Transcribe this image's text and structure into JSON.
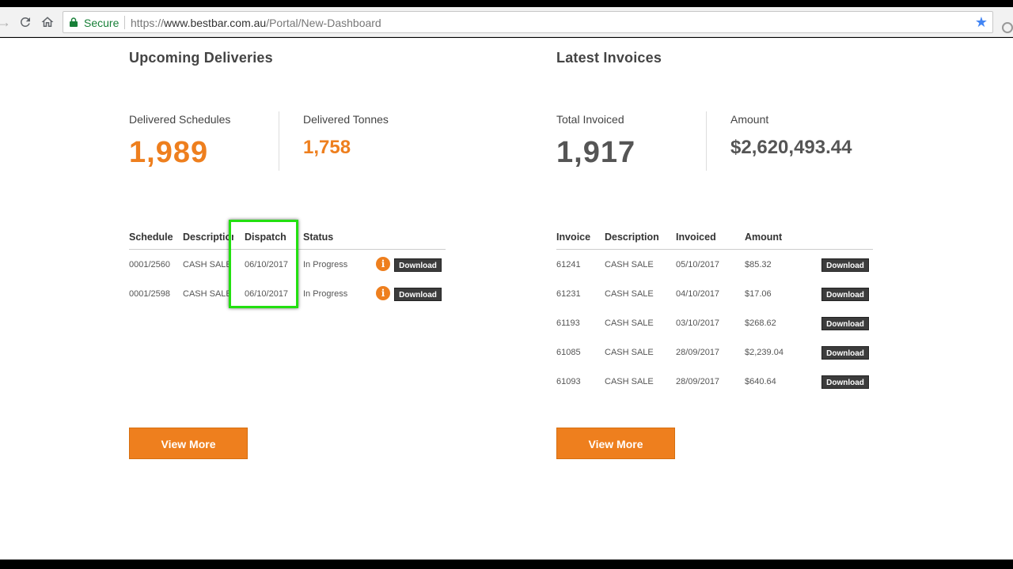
{
  "browser": {
    "secure_label": "Secure",
    "url_scheme": "https://",
    "url_host": "www.bestbar.com.au",
    "url_path": "/Portal/New-Dashboard"
  },
  "deliveries": {
    "title": "Upcoming Deliveries",
    "stats": [
      {
        "label": "Delivered Schedules",
        "value": "1,989"
      },
      {
        "label": "Delivered Tonnes",
        "value": "1,758"
      }
    ],
    "columns": [
      "Schedule",
      "Description",
      "Dispatch",
      "Status"
    ],
    "rows": [
      {
        "schedule": "0001/2560",
        "description": "CASH SALE",
        "dispatch": "06/10/2017",
        "status": "In Progress",
        "info": "i",
        "download": "Download"
      },
      {
        "schedule": "0001/2598",
        "description": "CASH SALE",
        "dispatch": "06/10/2017",
        "status": "In Progress",
        "info": "i",
        "download": "Download"
      }
    ],
    "view_more": "View More"
  },
  "invoices": {
    "title": "Latest Invoices",
    "stats": [
      {
        "label": "Total Invoiced",
        "value": "1,917"
      },
      {
        "label": "Amount",
        "value": "$2,620,493.44"
      }
    ],
    "columns": [
      "Invoice",
      "Description",
      "Invoiced",
      "Amount"
    ],
    "rows": [
      {
        "invoice": "61241",
        "description": "CASH SALE",
        "invoiced": "05/10/2017",
        "amount": "$85.32",
        "download": "Download"
      },
      {
        "invoice": "61231",
        "description": "CASH SALE",
        "invoiced": "04/10/2017",
        "amount": "$17.06",
        "download": "Download"
      },
      {
        "invoice": "61193",
        "description": "CASH SALE",
        "invoiced": "03/10/2017",
        "amount": "$268.62",
        "download": "Download"
      },
      {
        "invoice": "61085",
        "description": "CASH SALE",
        "invoiced": "28/09/2017",
        "amount": "$2,239.04",
        "download": "Download"
      },
      {
        "invoice": "61093",
        "description": "CASH SALE",
        "invoiced": "28/09/2017",
        "amount": "$640.64",
        "download": "Download"
      }
    ],
    "view_more": "View More"
  },
  "colors": {
    "accent": "#ee7f1e",
    "highlight": "#22e010",
    "button_dark": "#3c3c3c"
  },
  "icons": {
    "nav_back": "arrow-left-icon",
    "nav_reload": "reload-icon",
    "nav_home": "home-icon",
    "secure": "lock-icon",
    "bookmark": "star-icon",
    "info": "info-icon"
  }
}
